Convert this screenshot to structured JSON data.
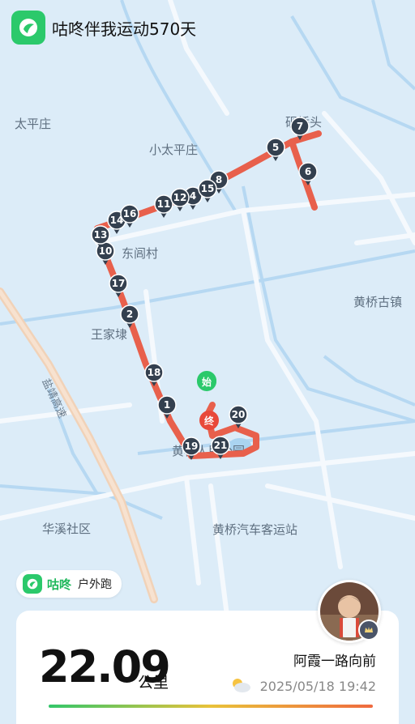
{
  "header": {
    "title": "咕咚伴我运动570天",
    "logo_icon": "gudong-app-icon"
  },
  "map": {
    "places": [
      "太平庄",
      "小太平庄",
      "砚桥头",
      "东闾村",
      "黄桥古镇",
      "王家埭",
      "黄桥人民公园",
      "华溪社区",
      "黄桥汽车客运站",
      "盐靖高速"
    ],
    "markers": [
      "1",
      "2",
      "4",
      "5",
      "6",
      "7",
      "8",
      "10",
      "11",
      "12",
      "13",
      "14",
      "15",
      "16",
      "17",
      "18",
      "19",
      "20",
      "21"
    ],
    "start_label": "始",
    "end_label": "终",
    "colors": {
      "route": "#e8604c",
      "pin": "#34404f",
      "start": "#2bc96b",
      "end": "#e8493a"
    }
  },
  "badge": {
    "brand": "咕咚",
    "type": "户外跑"
  },
  "card": {
    "distance": "22.09",
    "unit": "公里",
    "username": "阿霞一路向前",
    "datetime": "2025/05/18 19:42",
    "weather_icon": "partly-cloudy-icon"
  }
}
